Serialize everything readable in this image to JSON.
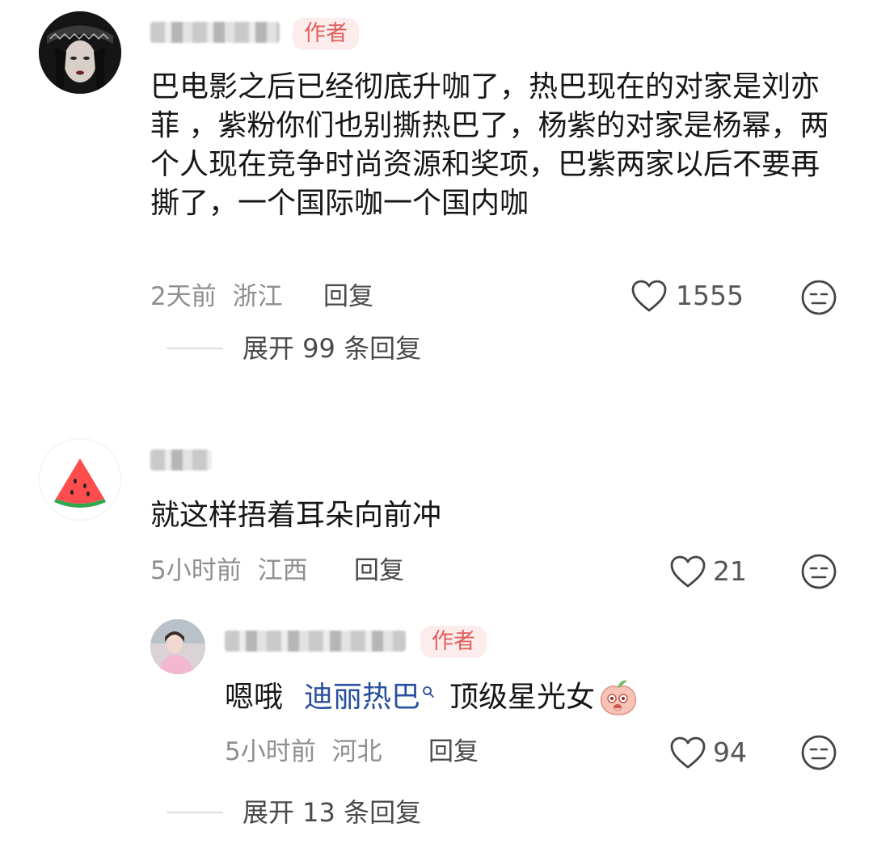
{
  "comments": [
    {
      "author_badge": "作者",
      "content": "巴电影之后已经彻底升咖了，热巴现在的对家是刘亦菲 ，紫粉你们也别撕热巴了，杨紫的对家是杨幂，两个人现在竞争时尚资源和奖项，巴紫两家以后不要再撕了，一个国际咖一个国内咖",
      "time": "2天前",
      "location": "浙江",
      "reply_label": "回复",
      "likes": "1555",
      "expand_label": "展开 99 条回复"
    },
    {
      "content": "就这样捂着耳朵向前冲",
      "time": "5小时前",
      "location": "江西",
      "reply_label": "回复",
      "likes": "21",
      "expand_label": "展开 13 条回复",
      "reply": {
        "author_badge": "作者",
        "content_prefix": "嗯哦",
        "mention": "迪丽热巴",
        "content_suffix": "顶级星光女",
        "time": "5小时前",
        "location": "河北",
        "reply_label": "回复",
        "likes": "94"
      }
    }
  ],
  "icons": {
    "like": "heart-outline-icon",
    "dislike": "neutral-face-icon",
    "mention_search": "search-icon",
    "emoji": "peach-face-emoji"
  },
  "colors": {
    "badge_bg": "#fdecec",
    "badge_text": "#e0605e",
    "mention": "#2a4f9e",
    "meta_gray": "#8e8e8e"
  }
}
